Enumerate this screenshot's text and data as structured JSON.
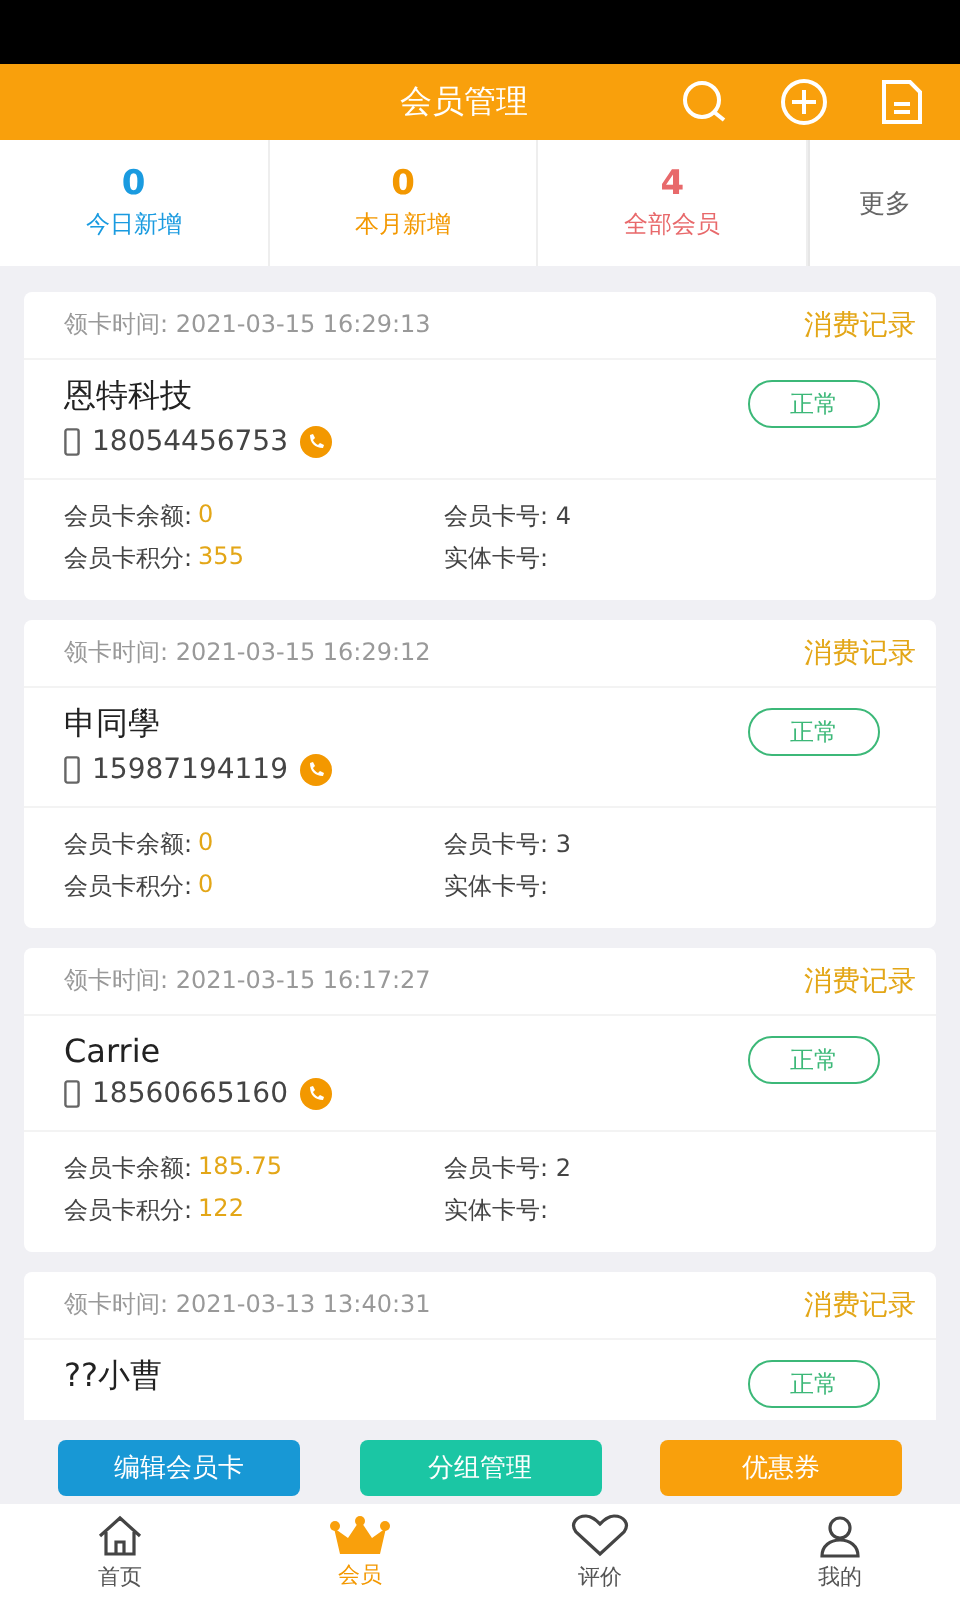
{
  "header": {
    "title": "会员管理"
  },
  "stats": [
    {
      "value": "0",
      "label": "今日新增",
      "color": "#1a9be0"
    },
    {
      "value": "0",
      "label": "本月新增",
      "color": "#f39800"
    },
    {
      "value": "4",
      "label": "全部会员",
      "color": "#e8696b"
    }
  ],
  "more": "更多",
  "members": [
    {
      "time": "领卡时间: 2021-03-15 16:29:13",
      "records": "消费记录",
      "name": "恩特科技",
      "phone": "18054456753",
      "status": "正常",
      "balance_label": "会员卡余额:",
      "balance": "0",
      "points_label": "会员卡积分:",
      "points": "355",
      "card_no": "会员卡号: 4",
      "physical": "实体卡号:"
    },
    {
      "time": "领卡时间: 2021-03-15 16:29:12",
      "records": "消费记录",
      "name": "申同學",
      "phone": "15987194119",
      "status": "正常",
      "balance_label": "会员卡余额:",
      "balance": "0",
      "points_label": "会员卡积分:",
      "points": "0",
      "card_no": "会员卡号: 3",
      "physical": "实体卡号:"
    },
    {
      "time": "领卡时间: 2021-03-15 16:17:27",
      "records": "消费记录",
      "name": "Carrie",
      "phone": "18560665160",
      "status": "正常",
      "balance_label": "会员卡余额:",
      "balance": "185.75",
      "points_label": "会员卡积分:",
      "points": "122",
      "card_no": "会员卡号: 2",
      "physical": "实体卡号:"
    },
    {
      "time": "领卡时间: 2021-03-13 13:40:31",
      "records": "消费记录",
      "name": "??小曹",
      "status": "正常"
    }
  ],
  "actions": [
    {
      "label": "编辑会员卡",
      "color": "#1898d5"
    },
    {
      "label": "分组管理",
      "color": "#1bc6a4"
    },
    {
      "label": "优惠券",
      "color": "#f9a00c"
    }
  ],
  "tabs": [
    {
      "label": "首页",
      "kind": "home",
      "selected": false
    },
    {
      "label": "会员",
      "kind": "crown",
      "selected": true
    },
    {
      "label": "评价",
      "kind": "heart",
      "selected": false
    },
    {
      "label": "我的",
      "kind": "user",
      "selected": false
    }
  ]
}
